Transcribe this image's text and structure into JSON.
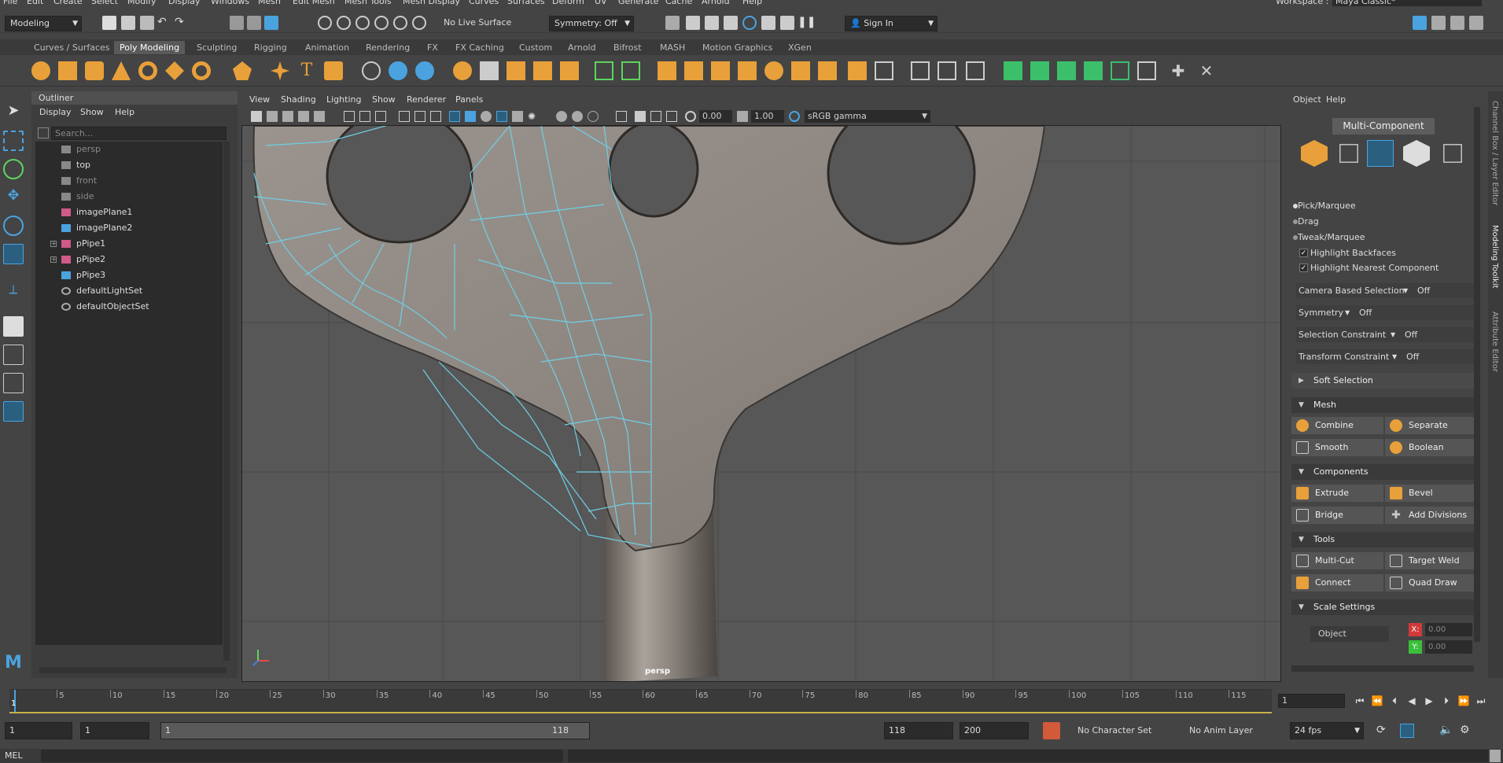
{
  "menubar": {
    "items": [
      "File",
      "Edit",
      "Create",
      "Select",
      "Modify",
      "Display",
      "Windows",
      "Mesh",
      "Edit Mesh",
      "Mesh Tools",
      "Mesh Display",
      "Curves",
      "Surfaces",
      "Deform",
      "UV",
      "Generate",
      "Cache",
      "Arnold",
      "Help"
    ],
    "workspace_label": "Workspace :",
    "workspace_value": "Maya Classic*"
  },
  "statusline": {
    "mode": "Modeling",
    "live_surface": "No Live Surface",
    "symmetry": "Symmetry: Off",
    "sign_in": "Sign In"
  },
  "shelf": {
    "tabs": [
      "Curves / Surfaces",
      "Poly Modeling",
      "Sculpting",
      "Rigging",
      "Animation",
      "Rendering",
      "FX",
      "FX Caching",
      "Custom",
      "Arnold",
      "Bifrost",
      "MASH",
      "Motion Graphics",
      "XGen"
    ],
    "active_tab": "Poly Modeling"
  },
  "outliner": {
    "title": "Outliner",
    "menus": [
      "Display",
      "Show",
      "Help"
    ],
    "search_placeholder": "Search...",
    "items": [
      {
        "label": "persp",
        "type": "camera",
        "dim": true
      },
      {
        "label": "top",
        "type": "camera",
        "dim": false
      },
      {
        "label": "front",
        "type": "camera",
        "dim": true
      },
      {
        "label": "side",
        "type": "camera",
        "dim": true
      },
      {
        "label": "imagePlane1",
        "type": "imageplane",
        "dim": false
      },
      {
        "label": "imagePlane2",
        "type": "imageplane",
        "dim": false
      },
      {
        "label": "pPipe1",
        "type": "mesh",
        "dim": false,
        "expandable": true
      },
      {
        "label": "pPipe2",
        "type": "mesh",
        "dim": false,
        "expandable": true
      },
      {
        "label": "pPipe3",
        "type": "mesh",
        "dim": false
      },
      {
        "label": "defaultLightSet",
        "type": "set",
        "dim": false
      },
      {
        "label": "defaultObjectSet",
        "type": "set",
        "dim": false
      }
    ]
  },
  "viewport": {
    "menus": [
      "View",
      "Shading",
      "Lighting",
      "Show",
      "Renderer",
      "Panels"
    ],
    "near_value": "0.00",
    "gamma_value": "1.00",
    "color_space": "sRGB gamma",
    "camera_label": "persp"
  },
  "toolkit": {
    "menus": [
      "Object",
      "Help"
    ],
    "multi_component": "Multi-Component",
    "radios": [
      "Pick/Marquee",
      "Drag",
      "Tweak/Marquee"
    ],
    "checkboxes": [
      "Highlight Backfaces",
      "Highlight Nearest Component"
    ],
    "options": [
      {
        "label": "Camera Based Selection",
        "value": "Off"
      },
      {
        "label": "Symmetry",
        "value": "Off"
      },
      {
        "label": "Selection Constraint",
        "value": "Off"
      },
      {
        "label": "Transform Constraint",
        "value": "Off"
      }
    ],
    "soft_selection": "Soft Selection",
    "sections": {
      "mesh": {
        "title": "Mesh",
        "buttons": [
          "Combine",
          "Separate",
          "Smooth",
          "Boolean"
        ]
      },
      "components": {
        "title": "Components",
        "buttons": [
          "Extrude",
          "Bevel",
          "Bridge",
          "Add Divisions"
        ]
      },
      "tools": {
        "title": "Tools",
        "buttons": [
          "Multi-Cut",
          "Target Weld",
          "Connect",
          "Quad Draw"
        ]
      },
      "scale": {
        "title": "Scale Settings",
        "object_label": "Object",
        "x_label": "X:",
        "x_value": "0.00",
        "y_label": "Y:",
        "y_value": "0.00"
      }
    }
  },
  "sidetabs": [
    "Channel Box / Layer Editor",
    "Modeling Toolkit",
    "Attribute Editor"
  ],
  "timeline": {
    "ticks": [
      "5",
      "10",
      "15",
      "20",
      "25",
      "30",
      "35",
      "40",
      "45",
      "50",
      "55",
      "60",
      "65",
      "70",
      "75",
      "80",
      "85",
      "90",
      "95",
      "100",
      "105",
      "110",
      "115"
    ],
    "current_frame_marker": "1",
    "current_frame": "1"
  },
  "range": {
    "start": "1",
    "playback_start": "1",
    "slider_start": "1",
    "slider_end": "118",
    "playback_end": "118",
    "end": "200",
    "character_set": "No Character Set",
    "anim_layer": "No Anim Layer",
    "fps": "24 fps"
  },
  "cmdline": {
    "lang": "MEL"
  },
  "colors": {
    "accent": "#4aa3df",
    "wire": "#6ecfe6",
    "active_tab": "#5a5a5a",
    "shelf_orange": "#e8a03a"
  }
}
